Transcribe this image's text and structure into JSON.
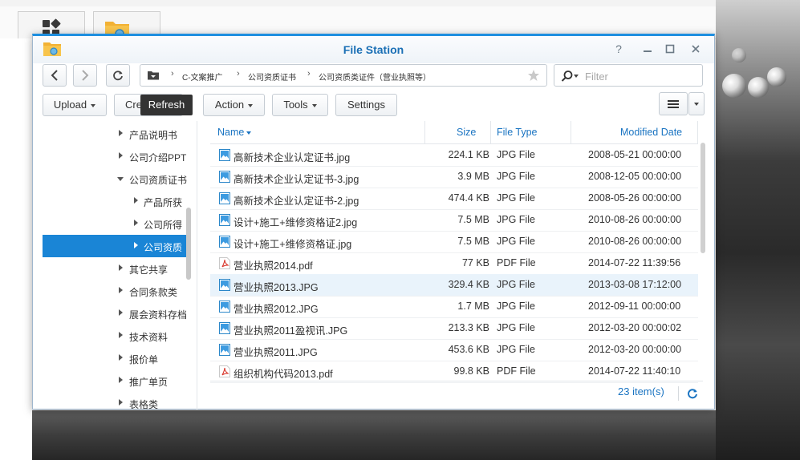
{
  "window": {
    "title": "File Station"
  },
  "toolbar": {
    "upload": "Upload",
    "create": "Cre",
    "action": "Action",
    "tools": "Tools",
    "settings": "Settings",
    "tooltip": "Refresh"
  },
  "path": [
    "C-文案推广",
    "公司资质证书",
    "公司资质类证件（营业执照等）"
  ],
  "filter": {
    "placeholder": "Filter"
  },
  "tree": [
    {
      "label": "产品说明书"
    },
    {
      "label": "公司介绍PPT"
    },
    {
      "label": "公司资质证书"
    },
    {
      "label": "产品所获"
    },
    {
      "label": "公司所得"
    },
    {
      "label": "公司资质"
    },
    {
      "label": "其它共享"
    },
    {
      "label": "合同条款类"
    },
    {
      "label": "展会资料存档"
    },
    {
      "label": "技术资料"
    },
    {
      "label": "报价单"
    },
    {
      "label": "推广单页"
    },
    {
      "label": "表格类"
    }
  ],
  "table": {
    "headers": {
      "name": "Name",
      "size": "Size",
      "type": "File Type",
      "modified": "Modified Date"
    },
    "rows": [
      {
        "name": "高新技术企业认定证书.jpg",
        "size": "224.1 KB",
        "type": "JPG File",
        "modified": "2008-05-21 00:00:00",
        "kind": "jpg"
      },
      {
        "name": "高新技术企业认定证书-3.jpg",
        "size": "3.9 MB",
        "type": "JPG File",
        "modified": "2008-12-05 00:00:00",
        "kind": "jpg"
      },
      {
        "name": "高新技术企业认定证书-2.jpg",
        "size": "474.4 KB",
        "type": "JPG File",
        "modified": "2008-05-26 00:00:00",
        "kind": "jpg"
      },
      {
        "name": "设计+施工+维修资格证2.jpg",
        "size": "7.5 MB",
        "type": "JPG File",
        "modified": "2010-08-26 00:00:00",
        "kind": "jpg"
      },
      {
        "name": "设计+施工+维修资格证.jpg",
        "size": "7.5 MB",
        "type": "JPG File",
        "modified": "2010-08-26 00:00:00",
        "kind": "jpg"
      },
      {
        "name": "营业执照2014.pdf",
        "size": "77 KB",
        "type": "PDF File",
        "modified": "2014-07-22 11:39:56",
        "kind": "pdf"
      },
      {
        "name": "营业执照2013.JPG",
        "size": "329.4 KB",
        "type": "JPG File",
        "modified": "2013-03-08 17:12:00",
        "kind": "jpg"
      },
      {
        "name": "营业执照2012.JPG",
        "size": "1.7 MB",
        "type": "JPG File",
        "modified": "2012-09-11 00:00:00",
        "kind": "jpg"
      },
      {
        "name": "营业执照2011盈视讯.JPG",
        "size": "213.3 KB",
        "type": "JPG File",
        "modified": "2012-03-20 00:00:02",
        "kind": "jpg"
      },
      {
        "name": "营业执照2011.JPG",
        "size": "453.6 KB",
        "type": "JPG File",
        "modified": "2012-03-20 00:00:00",
        "kind": "jpg"
      },
      {
        "name": "组织机构代码2013.pdf",
        "size": "99.8 KB",
        "type": "PDF File",
        "modified": "2014-07-22 11:40:10",
        "kind": "pdf"
      }
    ]
  },
  "footer": {
    "count": "23 item(s)"
  },
  "colors": {
    "accent": "#1a85d6",
    "link": "#1a74c2",
    "selectedRow": "#e9f3fb"
  }
}
